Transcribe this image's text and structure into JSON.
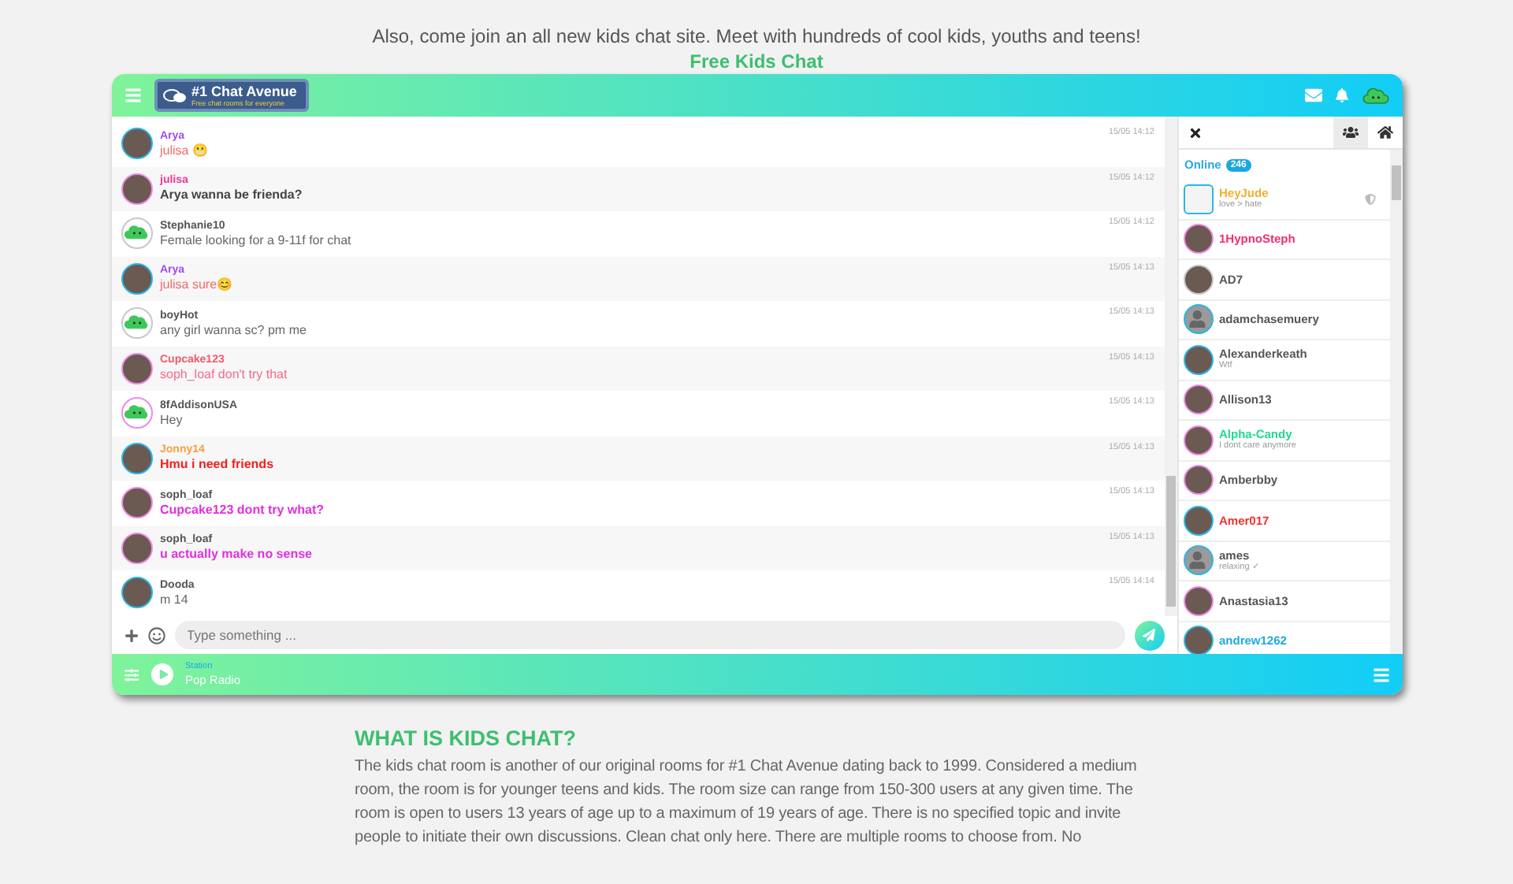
{
  "intro": {
    "invite": "Also, come join an all new kids chat site. Meet with hundreds of cool kids, youths and teens!",
    "link": "Free Kids Chat"
  },
  "header": {
    "logo_title": "#1 Chat Avenue",
    "logo_subtitle": "Free chat rooms for everyone"
  },
  "messages": [
    {
      "name": "Arya",
      "color": "#a04ef0",
      "body": {
        "text": "julisa 😬",
        "color": "#f06a6a",
        "bold": false
      },
      "avatar": {
        "kind": "photo",
        "color": "#29b6e8"
      },
      "time": "15/05 14:12"
    },
    {
      "name": "julisa",
      "color": "#f0389a",
      "body": {
        "text": "Arya wanna be frienda?",
        "color": "#444444",
        "bold": true
      },
      "avatar": {
        "kind": "photo",
        "color": "#f08ae8"
      },
      "time": "15/05 14:12"
    },
    {
      "name": "Stephanie10",
      "color": "#555555",
      "body": {
        "text": "Female looking for a 9-11f for chat",
        "color": "#666666",
        "bold": false
      },
      "avatar": {
        "kind": "cloud",
        "color": "#c8c8c8"
      },
      "time": "15/05 14:12"
    },
    {
      "name": "Arya",
      "color": "#a04ef0",
      "body": {
        "text": "julisa sure😊",
        "color": "#f06a6a",
        "bold": false
      },
      "avatar": {
        "kind": "photo",
        "color": "#29b6e8"
      },
      "time": "15/05 14:13"
    },
    {
      "name": "boyHot",
      "color": "#555555",
      "body": {
        "text": "any girl wanna sc? pm me",
        "color": "#666666",
        "bold": false
      },
      "avatar": {
        "kind": "cloud",
        "color": "#c8c8c8"
      },
      "time": "15/05 14:13"
    },
    {
      "name": "Cupcake123",
      "color": "#f05a6a",
      "body": {
        "text": "soph_loaf don't try that",
        "color": "#f06a8a",
        "bold": false
      },
      "avatar": {
        "kind": "photo",
        "color": "#f08ae8"
      },
      "time": "15/05 14:13"
    },
    {
      "name": "8fAddisonUSA",
      "color": "#555555",
      "body": {
        "text": "Hey",
        "color": "#666666",
        "bold": false
      },
      "avatar": {
        "kind": "cloud",
        "color": "#f08ae8"
      },
      "time": "15/05 14:13"
    },
    {
      "name": "Jonny14",
      "color": "#f5a040",
      "body": {
        "text": "Hmu i need friends",
        "color": "#f02020",
        "bold": true
      },
      "avatar": {
        "kind": "photo",
        "color": "#29b6e8"
      },
      "time": "15/05 14:13"
    },
    {
      "name": "soph_loaf",
      "color": "#555555",
      "body": {
        "text": "Cupcake123 dont try what?",
        "color": "#e030e0",
        "bold": true
      },
      "avatar": {
        "kind": "photo",
        "color": "#f08ae8"
      },
      "time": "15/05 14:13"
    },
    {
      "name": "soph_loaf",
      "color": "#555555",
      "body": {
        "text": "u actually make no sense",
        "color": "#e030e0",
        "bold": true
      },
      "avatar": {
        "kind": "photo",
        "color": "#f08ae8"
      },
      "time": "15/05 14:13"
    },
    {
      "name": "Dooda",
      "color": "#555555",
      "body": {
        "text": "m 14",
        "color": "#666666",
        "bold": false
      },
      "avatar": {
        "kind": "photo",
        "color": "#29b6e8"
      },
      "time": "15/05 14:14"
    }
  ],
  "composer": {
    "placeholder": "Type something ..."
  },
  "panel": {
    "tabs": [
      {
        "kind": "users",
        "selected": true
      },
      {
        "kind": "home",
        "selected": false
      }
    ],
    "online_label": "Online",
    "online_count": "246",
    "users": [
      {
        "name": "HeyJude",
        "color": "#f0b030",
        "status": "love > hate",
        "avatar": {
          "kind": "broken",
          "color": "#29b6e8"
        },
        "shield": true
      },
      {
        "name": "1HypnoSteph",
        "color": "#f0306a",
        "avatar": {
          "kind": "photo",
          "color": "#f08ae8"
        },
        "shield": false
      },
      {
        "name": "AD7",
        "color": "#555555",
        "avatar": {
          "kind": "photo",
          "color": "#c8c8c8"
        },
        "shield": false
      },
      {
        "name": "adamchasemuery",
        "color": "#555555",
        "avatar": {
          "kind": "silhouette",
          "color": "#29b6e8"
        },
        "shield": false
      },
      {
        "name": "Alexanderkeath",
        "color": "#555555",
        "status": "Wtf",
        "avatar": {
          "kind": "photo",
          "color": "#29b6e8"
        },
        "shield": false
      },
      {
        "name": "Allison13",
        "color": "#555555",
        "avatar": {
          "kind": "photo",
          "color": "#f08ae8"
        },
        "shield": false
      },
      {
        "name": "Alpha-Candy",
        "color": "#20d890",
        "status": "I dont care anymore",
        "avatar": {
          "kind": "photo",
          "color": "#f08ae8"
        },
        "shield": false
      },
      {
        "name": "Amberbby",
        "color": "#555555",
        "avatar": {
          "kind": "photo",
          "color": "#f08ae8"
        },
        "shield": false
      },
      {
        "name": "Amer017",
        "color": "#f03030",
        "avatar": {
          "kind": "photo",
          "color": "#29b6e8"
        },
        "shield": false
      },
      {
        "name": "ames",
        "color": "#555555",
        "status": "relaxing ✓",
        "avatar": {
          "kind": "silhouette",
          "color": "#29b6e8"
        },
        "shield": false
      },
      {
        "name": "Anastasia13",
        "color": "#555555",
        "avatar": {
          "kind": "photo",
          "color": "#f08ae8"
        },
        "shield": false
      },
      {
        "name": "andrew1262",
        "color": "#20a8e0",
        "avatar": {
          "kind": "photo",
          "color": "#29b6e8"
        },
        "shield": false
      }
    ]
  },
  "player": {
    "label": "Station",
    "station": "Pop Radio"
  },
  "article": {
    "heading": "WHAT IS KIDS CHAT?",
    "body": "The kids chat room is another of our original rooms for #1 Chat Avenue dating back to 1999. Considered a medium room, the room is for younger teens and kids. The room size can range from 150-300 users at any given time. The room is open to users 13 years of age up to a maximum of 19 years of age. There is no specified topic and invite people to initiate their own discussions. Clean chat only here. There are multiple rooms to choose from. No"
  }
}
